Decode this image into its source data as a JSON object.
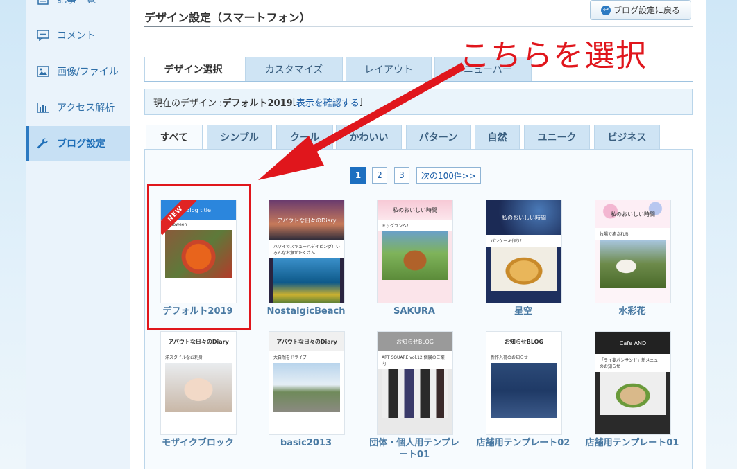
{
  "sidebar": {
    "items": [
      {
        "label": "記事一覧",
        "icon": "article-list-icon"
      },
      {
        "label": "コメント",
        "icon": "comment-icon"
      },
      {
        "label": "画像/ファイル",
        "icon": "image-icon"
      },
      {
        "label": "アクセス解析",
        "icon": "chart-icon"
      },
      {
        "label": "ブログ設定",
        "icon": "wrench-icon",
        "active": true
      }
    ]
  },
  "header": {
    "title": "デザイン設定（スマートフォン）",
    "back_button": "ブログ設定に戻る"
  },
  "tabs": [
    "デザイン選択",
    "カスタマイズ",
    "レイアウト",
    "メニューバー"
  ],
  "current_design": {
    "prefix": "現在のデザイン : ",
    "name": "デフォルト2019",
    "bracket_open": "[",
    "link": "表示を確認する",
    "bracket_close": "]"
  },
  "categories": [
    "すべて",
    "シンプル",
    "クール",
    "かわいい",
    "パターン",
    "自然",
    "ユニーク",
    "ビジネス"
  ],
  "pagination": {
    "pages": [
      "1",
      "2",
      "3"
    ],
    "next": "次の100件>>"
  },
  "templates": [
    {
      "name": "デフォルト2019",
      "head": "Blog title",
      "card": "Halloween",
      "badge": "NEW"
    },
    {
      "name": "NostalgicBeach",
      "head": "アバウトな日々のDiary",
      "card": "ハワイでスキューバダイビング！いろんなお魚がたくさん！"
    },
    {
      "name": "SAKURA",
      "head": "私のおいしい時間",
      "card": "ドッグランへ！"
    },
    {
      "name": "星空",
      "head": "私のおいしい時間",
      "card": "パンケーキ作り！"
    },
    {
      "name": "水彩花",
      "head": "私のおいしい時間",
      "card": "牧場で癒される"
    },
    {
      "name": "モザイクブロック",
      "head": "アバウトな日々のDiary",
      "card": "洋スタイルなお刺身"
    },
    {
      "name": "basic2013",
      "head": "アバウトな日々のDiary",
      "card": "大自然をドライブ"
    },
    {
      "name": "団体・個人用テンプレート01",
      "head": "お知らせBLOG",
      "card": "ART SQUARE vol.12 個展のご案内"
    },
    {
      "name": "店舗用テンプレート02",
      "head": "お知らせBLOG",
      "card": "新作入荷のお知らせ"
    },
    {
      "name": "店舗用テンプレート01",
      "head": "Cafe AND",
      "card": "「ライ麦パンサンド」新メニューのお知らせ"
    }
  ],
  "annotation": {
    "text": "こちらを選択"
  },
  "colors": {
    "accent": "#1d6fc0",
    "annotation": "#e0161c",
    "tab_bg": "#cfe4f4"
  }
}
